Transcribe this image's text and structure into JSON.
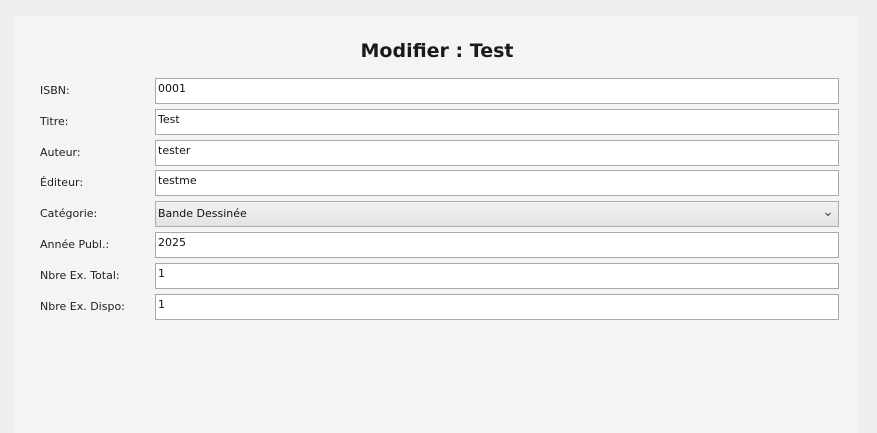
{
  "form": {
    "title": "Modifier : Test",
    "fields": [
      {
        "label": "ISBN:",
        "value": "0001"
      },
      {
        "label": "Titre:",
        "value": "Test"
      },
      {
        "label": "Auteur:",
        "value": "tester"
      },
      {
        "label": "Éditeur:",
        "value": "testme"
      },
      {
        "label": "Catégorie:",
        "value": "Bande Dessinée"
      },
      {
        "label": "Année Publ.:",
        "value": "2025"
      },
      {
        "label": "Nbre Ex. Total:",
        "value": "1"
      },
      {
        "label": "Nbre Ex. Dispo:",
        "value": "1"
      }
    ]
  },
  "icons": {
    "dropdown": "chevron-down-icon"
  },
  "colors": {
    "panel_bg": "#f4f4f4",
    "window_bg": "#efefef",
    "field_border": "#a9a9a9"
  }
}
